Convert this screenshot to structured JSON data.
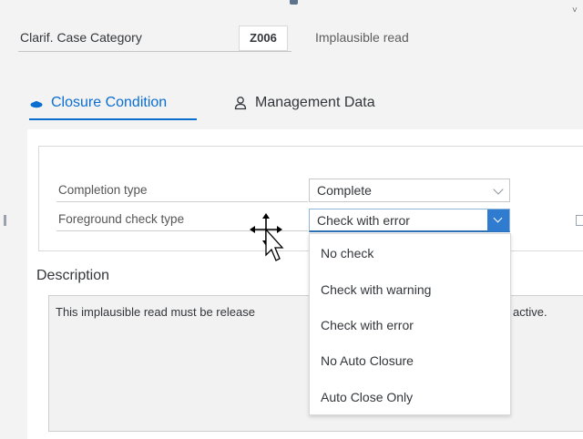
{
  "header": {
    "category_label": "Clarif. Case Category",
    "category_code": "Z006",
    "category_description": "Implausible read"
  },
  "tabs": [
    {
      "label": "Closure Condition",
      "icon": "closure-condition-icon",
      "active": true
    },
    {
      "label": "Management Data",
      "icon": "person-icon",
      "active": false
    }
  ],
  "form": {
    "completion_type_label": "Completion type",
    "completion_type_value": "Complete",
    "foreground_check_label": "Foreground check type",
    "foreground_check_value": "Check with error"
  },
  "dropdown": {
    "options": [
      "No check",
      "Check with warning",
      "Check with error",
      "No Auto Closure",
      "Auto Close Only"
    ],
    "selected": "Check with error"
  },
  "description": {
    "title": "Description",
    "text_part1": "This implausible read must be release",
    "text_part2": "active."
  },
  "colors": {
    "accent": "#0a6ed1",
    "button_blue": "#2f7bd0"
  }
}
